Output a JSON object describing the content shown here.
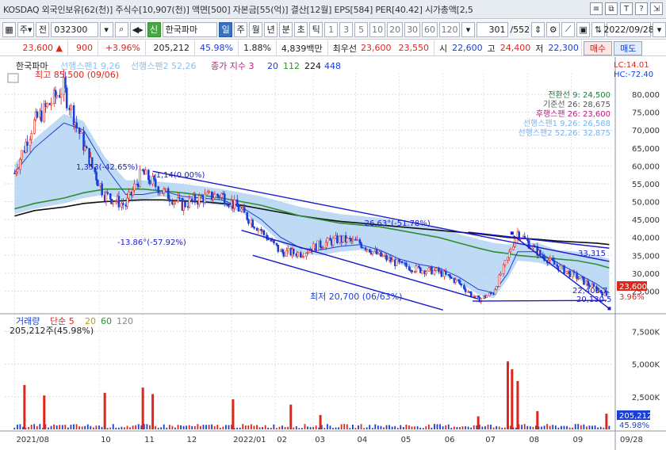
{
  "info_bar": {
    "text": "KOSDAQ 외국인보유[62(천)] 주식수[10,907(천)] 액면[500] 자본금[55(억)] 결산[12월] EPS[584] PER[40.42] 시가총액[2,5",
    "icons": [
      "list-icon",
      "copy-icon",
      "text-icon",
      "help-icon",
      "link-icon"
    ]
  },
  "toolbar": {
    "grid_label": "▦",
    "ju_label": "주",
    "jeon_label": "전",
    "code": "032300",
    "search_icon": "🔍",
    "sound_icon": "🔊",
    "sin_label": "신",
    "name": "한국파마",
    "period_tabs": [
      "일",
      "주",
      "월",
      "년",
      "분",
      "초",
      "틱"
    ],
    "active_tab": "일",
    "minutes": [
      "1",
      "3",
      "5",
      "10",
      "20",
      "30",
      "60",
      "120"
    ],
    "count": "301",
    "total": "/552",
    "date": "2022/09/28"
  },
  "price_bar": {
    "price": "23,600 ▲",
    "change": "900",
    "change_pct": "+3.96%",
    "volume": "205,212",
    "vol_pct": "45.98%",
    "turnover": "1.88%",
    "amount": "4,839백만",
    "best_label": "최우선",
    "best_ask": "23,600",
    "best_bid": "23,550",
    "open_label": "시",
    "open": "22,600",
    "high_label": "고",
    "high": "24,400",
    "low_label": "저",
    "low": "22,300",
    "buy_label": "매수",
    "sell_label": "매도"
  },
  "chart_data": {
    "type": "candlestick",
    "stock_name": "한국파마",
    "legend": {
      "ichimoku1": "선행스팬1 9,26",
      "ichimoku2": "선행스팬2 52,26",
      "ma_label": "종가 지수 3",
      "ma_periods": [
        "20",
        "112",
        "224",
        "448"
      ]
    },
    "ichimoku_values": [
      {
        "label": "전환선 9: 24,500",
        "color": "#1f7a3f"
      },
      {
        "label": "기준선 26: 28,675",
        "color": "#555555"
      },
      {
        "label": "후행스팬 26: 23,600",
        "color": "#b5207e"
      },
      {
        "label": "선행스팬1 9,26: 26,588",
        "color": "#7ab3ea"
      },
      {
        "label": "선행스팬2 52,26: 32,875",
        "color": "#7ab3ea"
      }
    ],
    "lc": "LC:14.01",
    "hc": "HC:-72.40",
    "high_label": "최고 85,500 (09/06)",
    "low_label": "최저 20,700 (06/63%)",
    "annotations": [
      {
        "text": "1,353(-42.65%)",
        "x": "2021-11",
        "y": 58000
      },
      {
        "text": "-1,14(0.00%)",
        "x": "2021-12",
        "y": 56500
      },
      {
        "text": "-13.86°(-57.92%)",
        "x": "2022-02",
        "y": 34000
      },
      {
        "text": "-26.63°(-51.78%)",
        "x": "2022-07",
        "y": 42500
      }
    ],
    "right_labels": [
      {
        "text": "33,315",
        "y": 33315
      },
      {
        "text": "22,403.7",
        "y": 22404
      },
      {
        "text": "20,130.5",
        "y": 20130
      }
    ],
    "current_price": "23,600",
    "current_pct": "3.96%",
    "ylim": [
      20000,
      86000
    ],
    "y_ticks": [
      "80,000",
      "75,000",
      "70,000",
      "65,000",
      "60,000",
      "55,000",
      "50,000",
      "45,000",
      "40,000",
      "35,000",
      "30,000",
      "25,000"
    ],
    "x_labels": [
      "2021/08",
      "10",
      "11",
      "12",
      "2022/01",
      "02",
      "03",
      "04",
      "05",
      "06",
      "07",
      "08",
      "09",
      "09/28"
    ],
    "price_series": [
      {
        "date": "2021-08-02",
        "close": 58000
      },
      {
        "date": "2021-08-16",
        "close": 72000
      },
      {
        "date": "2021-09-06",
        "close": 82000
      },
      {
        "date": "2021-09-20",
        "close": 66000
      },
      {
        "date": "2021-10-05",
        "close": 52000
      },
      {
        "date": "2021-10-20",
        "close": 49000
      },
      {
        "date": "2021-11-01",
        "close": 58000
      },
      {
        "date": "2021-11-15",
        "close": 53000
      },
      {
        "date": "2021-11-29",
        "close": 49000
      },
      {
        "date": "2021-12-13",
        "close": 51000
      },
      {
        "date": "2021-12-27",
        "close": 52000
      },
      {
        "date": "2022-01-10",
        "close": 47500
      },
      {
        "date": "2022-01-24",
        "close": 42000
      },
      {
        "date": "2022-02-07",
        "close": 36000
      },
      {
        "date": "2022-02-21",
        "close": 35500
      },
      {
        "date": "2022-03-07",
        "close": 38000
      },
      {
        "date": "2022-03-21",
        "close": 39500
      },
      {
        "date": "2022-04-04",
        "close": 38500
      },
      {
        "date": "2022-04-18",
        "close": 35000
      },
      {
        "date": "2022-05-02",
        "close": 32500
      },
      {
        "date": "2022-05-16",
        "close": 31000
      },
      {
        "date": "2022-05-30",
        "close": 30500
      },
      {
        "date": "2022-06-13",
        "close": 27500
      },
      {
        "date": "2022-06-27",
        "close": 22500
      },
      {
        "date": "2022-07-08",
        "close": 24500
      },
      {
        "date": "2022-07-18",
        "close": 34000
      },
      {
        "date": "2022-07-25",
        "close": 41500
      },
      {
        "date": "2022-08-08",
        "close": 36000
      },
      {
        "date": "2022-08-22",
        "close": 32000
      },
      {
        "date": "2022-09-05",
        "close": 29000
      },
      {
        "date": "2022-09-19",
        "close": 25500
      },
      {
        "date": "2022-09-28",
        "close": 23600
      }
    ],
    "ma20": [
      58000,
      65000,
      72000,
      70000,
      60000,
      52000,
      52000,
      53000,
      51500,
      51000,
      50500,
      48500,
      45000,
      40000,
      37000,
      36500,
      37500,
      38000,
      36500,
      34000,
      32500,
      31500,
      29000,
      25500,
      24500,
      30000,
      36000,
      36000,
      33000,
      30000,
      27000,
      24500
    ],
    "ma112": [
      48000,
      49500,
      51000,
      52500,
      53500,
      53500,
      53500,
      53000,
      52500,
      51800,
      51000,
      50000,
      49000,
      47500,
      46000,
      45000,
      44000,
      43500,
      43000,
      42000,
      41000,
      40000,
      38500,
      37000,
      36000,
      35500,
      35000,
      34500,
      34000,
      33500,
      32500,
      31500
    ],
    "ma224": [
      46000,
      47500,
      48500,
      49500,
      50000,
      50300,
      50500,
      50500,
      50200,
      50000,
      49500,
      49000,
      48000,
      47000,
      46000,
      45200,
      44500,
      44000,
      43500,
      43000,
      42500,
      42000,
      41500,
      41000,
      40500,
      40000,
      39800,
      39500,
      39000,
      38700,
      38400,
      38000
    ],
    "volume_panel": {
      "label": "거래량",
      "ma_label": "단순 5",
      "ma_periods": [
        "20",
        "60",
        "120"
      ],
      "current": "205,212주(45.98%)",
      "current_value": "205,212",
      "current_pct": "45.98%",
      "y_ticks": [
        "7,500K",
        "5,000K",
        "2,500K"
      ],
      "ylim": [
        0,
        8000000
      ],
      "spikes": [
        {
          "date": "2021-08-09",
          "value": 3400000
        },
        {
          "date": "2021-08-23",
          "value": 2600000
        },
        {
          "date": "2021-10-05",
          "value": 2800000
        },
        {
          "date": "2021-11-01",
          "value": 3200000
        },
        {
          "date": "2021-11-08",
          "value": 2700000
        },
        {
          "date": "2022-01-04",
          "value": 2300000
        },
        {
          "date": "2022-02-14",
          "value": 1900000
        },
        {
          "date": "2022-03-07",
          "value": 1100000
        },
        {
          "date": "2022-06-27",
          "value": 1000000
        },
        {
          "date": "2022-07-18",
          "value": 5200000
        },
        {
          "date": "2022-07-21",
          "value": 4600000
        },
        {
          "date": "2022-07-25",
          "value": 3700000
        },
        {
          "date": "2022-08-08",
          "value": 1400000
        },
        {
          "date": "2022-09-26",
          "value": 1200000
        }
      ]
    }
  },
  "colors": {
    "up": "#e0261c",
    "down": "#1b3fd6",
    "cloud": "#a9cdf2",
    "ma20": "#1b3fd6",
    "ma112": "#2f8f2f",
    "ma224": "#111111",
    "trend": "#1a1acc"
  }
}
